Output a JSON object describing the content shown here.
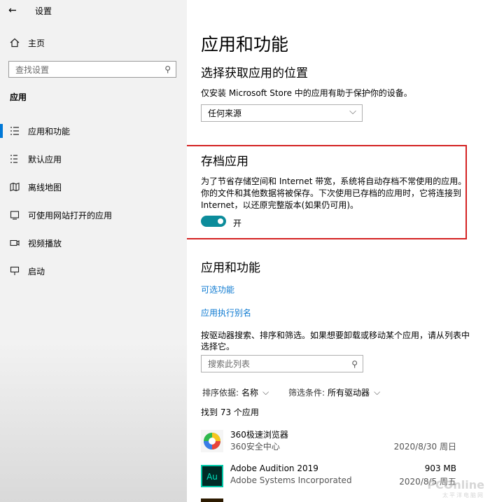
{
  "window": {
    "title": "设置"
  },
  "sidebar": {
    "home_label": "主页",
    "search_placeholder": "查找设置",
    "section_title": "应用",
    "items": [
      {
        "label": "应用和功能",
        "icon": "apps-list-icon",
        "selected": true
      },
      {
        "label": "默认应用",
        "icon": "default-apps-icon"
      },
      {
        "label": "离线地图",
        "icon": "offline-maps-icon"
      },
      {
        "label": "可使用网站打开的应用",
        "icon": "apps-for-websites-icon"
      },
      {
        "label": "视频播放",
        "icon": "video-playback-icon"
      },
      {
        "label": "启动",
        "icon": "startup-icon"
      }
    ]
  },
  "main": {
    "title": "应用和功能",
    "choose_location": {
      "heading": "选择获取应用的位置",
      "description": "仅安装 Microsoft Store 中的应用有助于保护你的设备。",
      "dropdown_value": "任何来源"
    },
    "archive": {
      "heading": "存档应用",
      "line1": "为了节省存储空间和 Internet 带宽，系统将自动存档不常使用的应用。",
      "line2": "你的文件和其他数据将被保存。下次使用已存档的应用时，它将连接到",
      "line3": "Internet，以还原完整版本(如果仍可用)。",
      "toggle_state": "开",
      "toggle_on": true
    },
    "apps_features": {
      "heading": "应用和功能",
      "link_optional": "可选功能",
      "link_alias": "应用执行别名",
      "description_line1": "按驱动器搜索、排序和筛选。如果想要卸载或移动某个应用，请从列表中",
      "description_line2": "选择它。",
      "search_placeholder": "搜索此列表",
      "sort_label": "排序依据:",
      "sort_value": "名称",
      "filter_label": "筛选条件:",
      "filter_value": "所有驱动器",
      "count_text": "找到 73 个应用",
      "apps": [
        {
          "name": "360极速浏览器",
          "publisher": "360安全中心",
          "size": "",
          "date": "2020/8/30 周日"
        },
        {
          "name": "Adobe Audition 2019",
          "publisher": "Adobe Systems Incorporated",
          "size": "903 MB",
          "date": "2020/8/5 周五"
        }
      ]
    }
  },
  "watermark": {
    "brand": "PCOnline",
    "sub": "太平洋电脑网"
  },
  "colors": {
    "accent": "#0078d7",
    "toggle": "#0c8c9b",
    "link": "#0e7ad1",
    "highlight_box": "#d42222"
  }
}
